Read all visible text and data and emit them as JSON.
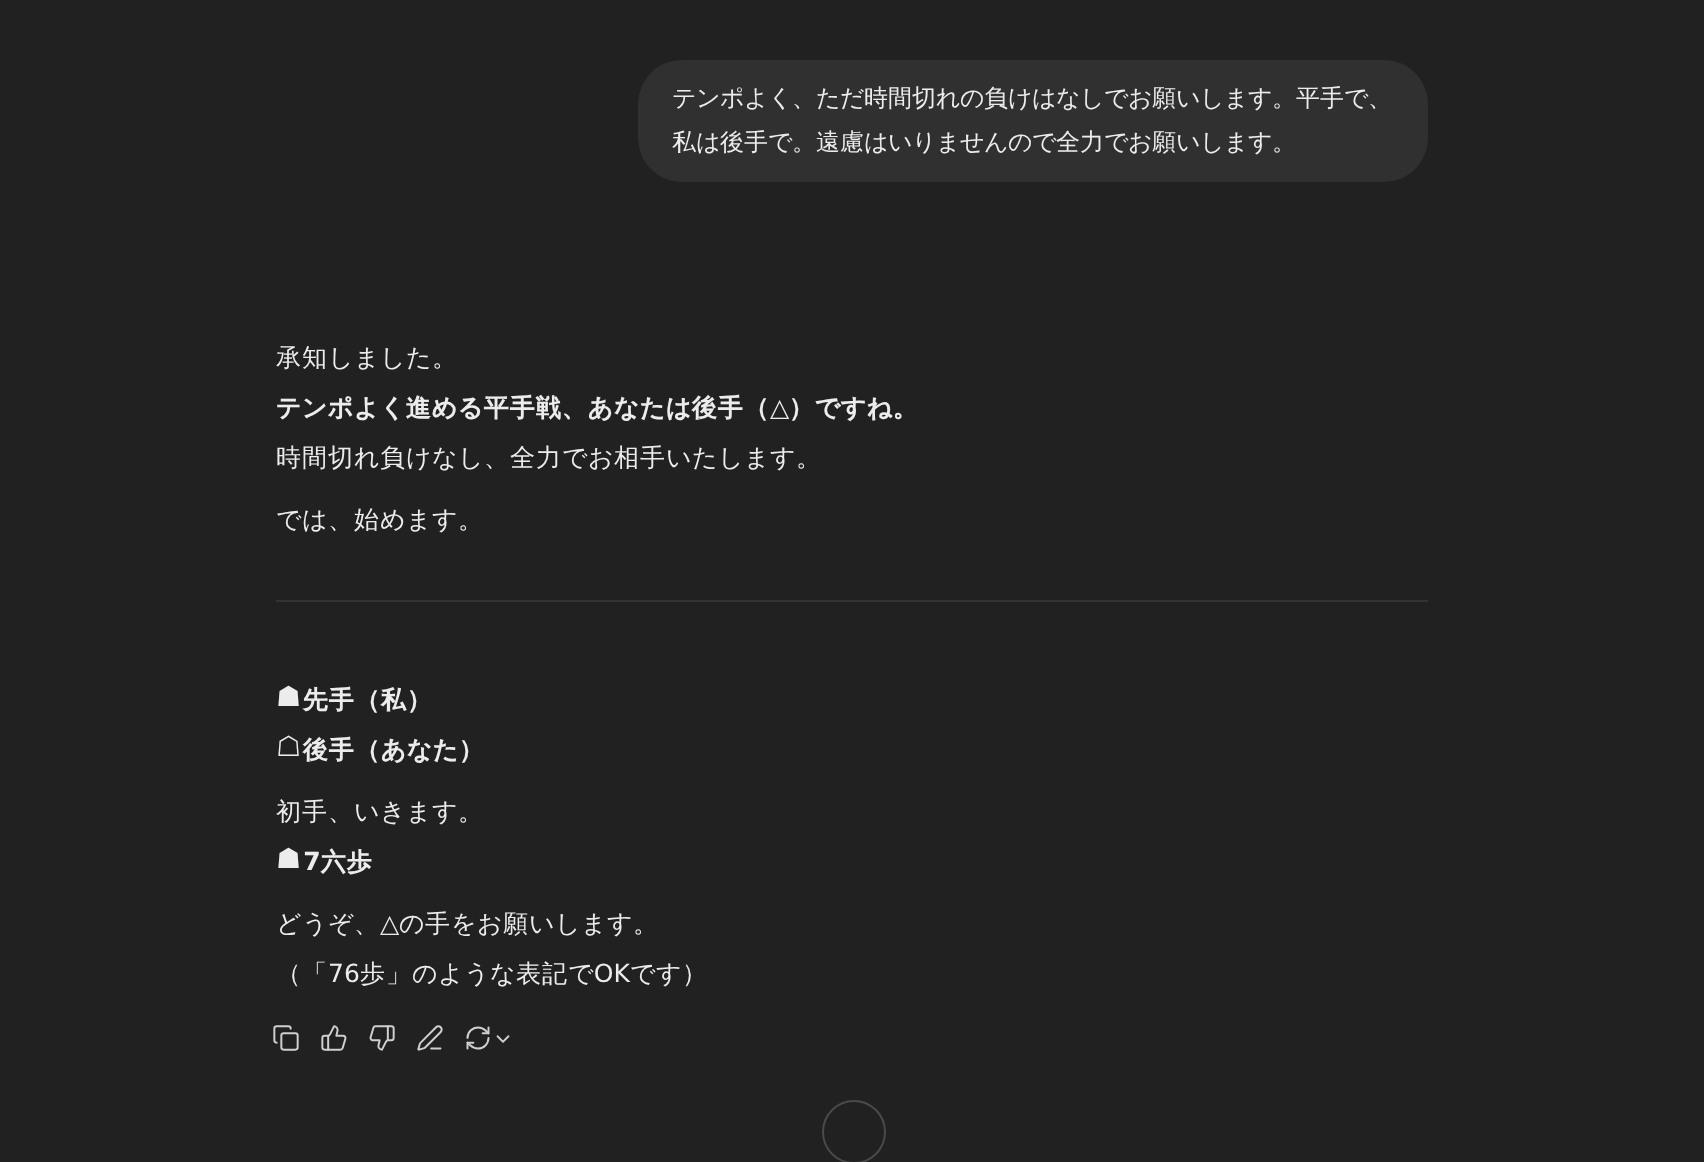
{
  "user_message": {
    "lines": [
      "テンポよく、ただ時間切れの負けはなしでお願いします。平手で、",
      "私は後手で。遠慮はいりませんので全力でお願いします。"
    ]
  },
  "reply_intro": [
    {
      "lines": [
        {
          "text": "承知しました。",
          "bold": false
        },
        {
          "text": "テンポよく進める平手戦、あなたは後手（△）ですね。",
          "bold": true
        },
        {
          "text": "時間切れ負けなし、全力でお相手いたします。",
          "bold": false
        }
      ]
    },
    {
      "lines": [
        {
          "text": "では、始めます。",
          "bold": false
        }
      ]
    }
  ],
  "reply_game": [
    {
      "lines": [
        {
          "piece": "☗",
          "text": "先手（私）",
          "bold": true
        },
        {
          "piece": "☖",
          "text": "後手（あなた）",
          "bold": true
        }
      ]
    },
    {
      "lines": [
        {
          "text": "初手、いきます。",
          "bold": false
        },
        {
          "piece": "☗",
          "text": "7六歩",
          "bold": true
        }
      ]
    },
    {
      "lines": [
        {
          "text": "どうぞ、△の手をお願いします。",
          "bold": false
        },
        {
          "text": "（「76歩」のような表記でOKです）",
          "bold": false
        }
      ]
    }
  ],
  "actions": [
    {
      "kind": "copy"
    },
    {
      "kind": "like"
    },
    {
      "kind": "dislike"
    },
    {
      "kind": "edit"
    },
    {
      "kind": "regenerate"
    }
  ]
}
